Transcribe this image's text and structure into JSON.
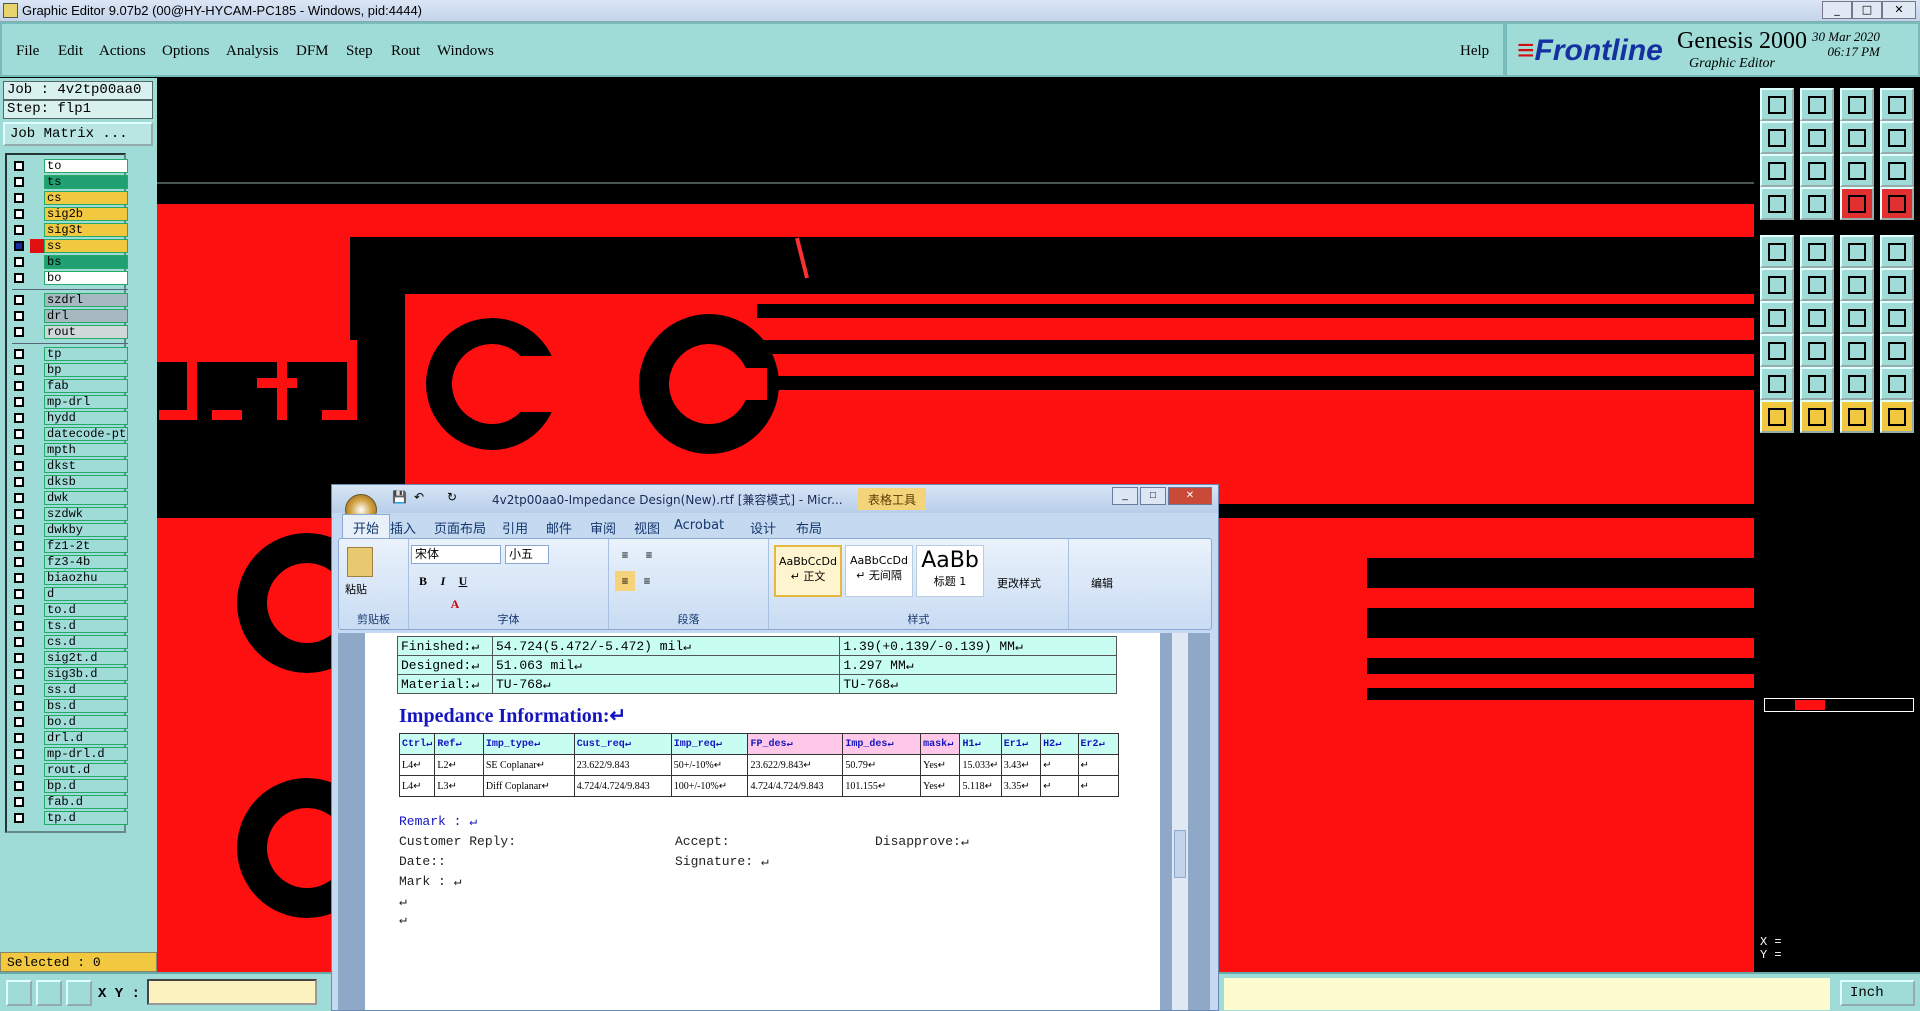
{
  "window_title": "Graphic Editor 9.07b2 (00@HY-HYCAM-PC185 - Windows, pid:4444)",
  "menu": [
    "File",
    "Edit",
    "Actions",
    "Options",
    "Analysis",
    "DFM",
    "Step",
    "Rout",
    "Windows"
  ],
  "help": "Help",
  "brand": {
    "logo": "Frontline",
    "product": "Genesis 2000",
    "subtitle": "Graphic Editor",
    "date": "30 Mar 2020",
    "time": "06:17 PM"
  },
  "job": {
    "job": "Job : 4v2tp00aa0",
    "step": "Step: flp1",
    "matrix": "Job Matrix ..."
  },
  "layers": [
    {
      "name": "to",
      "color": "#ffffff"
    },
    {
      "name": "ts",
      "color": "#20a070"
    },
    {
      "name": "cs",
      "color": "#f2c840"
    },
    {
      "name": "sig2b",
      "color": "#f2c840"
    },
    {
      "name": "sig3t",
      "color": "#f2c840"
    },
    {
      "name": "ss",
      "color": "#f2c840",
      "active": true
    },
    {
      "name": "bs",
      "color": "#20a070"
    },
    {
      "name": "bo",
      "color": "#ffffff"
    },
    {
      "name": "szdrl",
      "color": "#a8b8c0"
    },
    {
      "name": "drl",
      "color": "#a8b8c0"
    },
    {
      "name": "rout",
      "color": "#d0d8d8"
    },
    {
      "name": "tp",
      "color": "#9fdcd7"
    },
    {
      "name": "bp",
      "color": "#9fdcd7"
    },
    {
      "name": "fab",
      "color": "#9fdcd7"
    },
    {
      "name": "mp-drl",
      "color": "#9fdcd7"
    },
    {
      "name": "hydd",
      "color": "#9fdcd7"
    },
    {
      "name": "datecode-ptc",
      "color": "#9fdcd7"
    },
    {
      "name": "mpth",
      "color": "#9fdcd7"
    },
    {
      "name": "dkst",
      "color": "#9fdcd7"
    },
    {
      "name": "dksb",
      "color": "#9fdcd7"
    },
    {
      "name": "dwk",
      "color": "#9fdcd7"
    },
    {
      "name": "szdwk",
      "color": "#9fdcd7"
    },
    {
      "name": "dwkby",
      "color": "#9fdcd7"
    },
    {
      "name": "fz1-2t",
      "color": "#9fdcd7"
    },
    {
      "name": "fz3-4b",
      "color": "#9fdcd7"
    },
    {
      "name": "biaozhu",
      "color": "#9fdcd7"
    },
    {
      "name": "d",
      "color": "#9fdcd7"
    },
    {
      "name": "to.d",
      "color": "#9fdcd7"
    },
    {
      "name": "ts.d",
      "color": "#9fdcd7"
    },
    {
      "name": "cs.d",
      "color": "#9fdcd7"
    },
    {
      "name": "sig2t.d",
      "color": "#9fdcd7"
    },
    {
      "name": "sig3b.d",
      "color": "#9fdcd7"
    },
    {
      "name": "ss.d",
      "color": "#9fdcd7"
    },
    {
      "name": "bs.d",
      "color": "#9fdcd7"
    },
    {
      "name": "bo.d",
      "color": "#9fdcd7"
    },
    {
      "name": "drl.d",
      "color": "#9fdcd7"
    },
    {
      "name": "mp-drl.d",
      "color": "#9fdcd7"
    },
    {
      "name": "rout.d",
      "color": "#9fdcd7"
    },
    {
      "name": "bp.d",
      "color": "#9fdcd7"
    },
    {
      "name": "fab.d",
      "color": "#9fdcd7"
    },
    {
      "name": "tp.d",
      "color": "#9fdcd7"
    }
  ],
  "selected": "Selected : 0",
  "status": {
    "xy_label": "X Y :",
    "unit": "Inch",
    "coord_x": "X =",
    "coord_y": "Y ="
  },
  "word": {
    "doc_title": "4v2tp00aa0-Impedance Design(New).rtf [兼容模式] - Micr...",
    "table_tools": "表格工具",
    "tabs": [
      "开始",
      "插入",
      "页面布局",
      "引用",
      "邮件",
      "审阅",
      "视图",
      "Acrobat",
      "设计",
      "布局"
    ],
    "font": "宋体",
    "size": "小五",
    "paste": "粘贴",
    "styles": [
      {
        "sample": "AaBbCcDd",
        "name": "↵ 正文"
      },
      {
        "sample": "AaBbCcDd",
        "name": "↵ 无间隔"
      },
      {
        "sample": "AaBb",
        "name": "标题 1"
      }
    ],
    "change_style": "更改样式",
    "edit": "编辑",
    "groups": [
      "剪贴板",
      "字体",
      "段落",
      "样式"
    ],
    "spec_rows": [
      [
        "Finished:↵",
        "54.724(5.472/-5.472) mil↵",
        "1.39(+0.139/-0.139) MM↵"
      ],
      [
        "Designed:↵",
        "51.063 mil↵",
        "1.297 MM↵"
      ],
      [
        "Material:↵",
        "TU-768↵",
        "TU-768↵"
      ]
    ],
    "imp_heading": "Impedance Information:↵",
    "imp_header": [
      "Ctrl↵",
      "Ref↵",
      "Imp_type↵",
      "Cust_req↵",
      "Imp_req↵",
      "FP_des↵",
      "Imp_des↵",
      "mask↵",
      "H1↵",
      "Er1↵",
      "H2↵",
      "Er2↵"
    ],
    "imp_rows": [
      [
        "L4↵",
        "L2↵",
        "SE Coplanar↵",
        "23.622/9.843",
        "50+/-10%↵",
        "23.622/9.843↵",
        "50.79↵",
        "Yes↵",
        "15.033↵",
        "3.43↵",
        "↵",
        "↵"
      ],
      [
        "L4↵",
        "L3↵",
        "Diff Coplanar↵",
        "4.724/4.724/9.843",
        "100+/-10%↵",
        "4.724/4.724/9.843",
        "101.155↵",
        "Yes↵",
        "5.118↵",
        "3.35↵",
        "↵",
        "↵"
      ]
    ],
    "remark": "Remark : ↵",
    "customer_reply": "Customer Reply:",
    "accept": "Accept:",
    "disapprove": "Disapprove:↵",
    "date": "Date::",
    "signature": "Signature: ↵",
    "mark": "Mark : ↵",
    "pmark1": "↵",
    "pmark2": "↵"
  },
  "colors": {
    "accent": "#9fdcd7",
    "copper": "#ff1010",
    "highlight": "#f2c840"
  }
}
